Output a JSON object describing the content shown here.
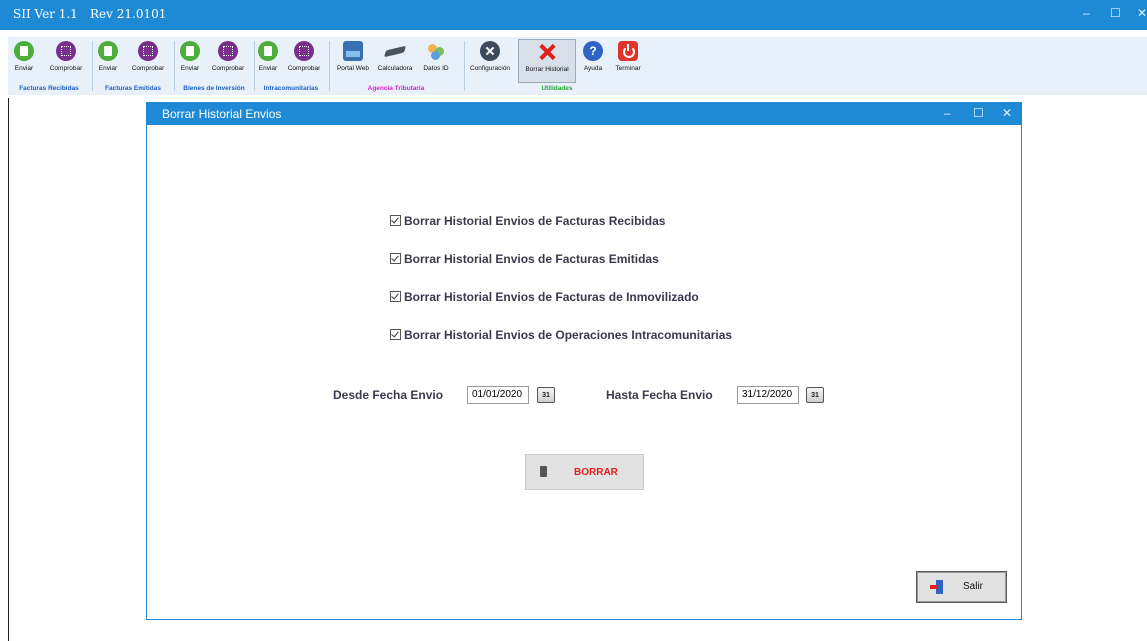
{
  "window": {
    "app_name": "SII  Ver 1.1",
    "revision": "Rev 21.0101",
    "minimize": "–",
    "maximize": "☐",
    "close": "✕"
  },
  "toolbar": {
    "groups": [
      {
        "caption": "Facturas Recibidas",
        "caption_color": "#1f5fbf",
        "tools": [
          {
            "label": "Enviar",
            "icon": "send-icon"
          },
          {
            "label": "Comprobar",
            "icon": "grid-icon"
          }
        ]
      },
      {
        "caption": "Facturas Emitidas",
        "caption_color": "#1f5fbf",
        "tools": [
          {
            "label": "Enviar",
            "icon": "send-icon"
          },
          {
            "label": "Comprobar",
            "icon": "grid-icon"
          }
        ]
      },
      {
        "caption": "Bienes de Inversión",
        "caption_color": "#1f5fbf",
        "tools": [
          {
            "label": "Enviar",
            "icon": "send-icon"
          },
          {
            "label": "Comprobar",
            "icon": "grid-icon"
          }
        ]
      },
      {
        "caption": "Intracomunitarias",
        "caption_color": "#1f5fbf",
        "tools": [
          {
            "label": "Enviar",
            "icon": "send-icon"
          },
          {
            "label": "Comprobar",
            "icon": "grid-icon"
          }
        ]
      },
      {
        "caption": "Agencia Tributaria",
        "caption_color": "#d424c8",
        "tools": [
          {
            "label": "Portal Web",
            "icon": "web-portal-icon"
          },
          {
            "label": "Calculadora",
            "icon": "calculator-icon"
          },
          {
            "label": "Datos ID",
            "icon": "users-icon"
          }
        ]
      },
      {
        "caption": "Utilidades",
        "caption_color": "#2ea33a",
        "tools": [
          {
            "label": "Configuración",
            "icon": "settings-icon"
          },
          {
            "label": "Borrar Historial",
            "icon": "delete-x-icon"
          },
          {
            "label": "Ayuda",
            "icon": "help-icon"
          },
          {
            "label": "Terminar",
            "icon": "power-icon"
          }
        ]
      }
    ]
  },
  "dialog": {
    "title": "Borrar Historial Envios",
    "minimize": "–",
    "maximize": "☐",
    "close": "✕",
    "options": [
      {
        "label": "Borrar Historial Envios de Facturas Recibidas",
        "checked": true
      },
      {
        "label": "Borrar Historial Envios de Facturas Emitidas",
        "checked": true
      },
      {
        "label": "Borrar Historial Envios de Facturas de Inmovilizado",
        "checked": true
      },
      {
        "label": "Borrar Historial Envios de Operaciones Intracomunitarias",
        "checked": true
      }
    ],
    "from_label": "Desde Fecha Envio",
    "from_value": "01/01/2020",
    "to_label": "Hasta Fecha Envio",
    "to_value": "31/12/2020",
    "calendar_glyph": "31",
    "delete_button": "BORRAR",
    "exit_button": "Salir"
  },
  "colors": {
    "accent": "#1e8ad6",
    "danger": "#e0211b"
  }
}
